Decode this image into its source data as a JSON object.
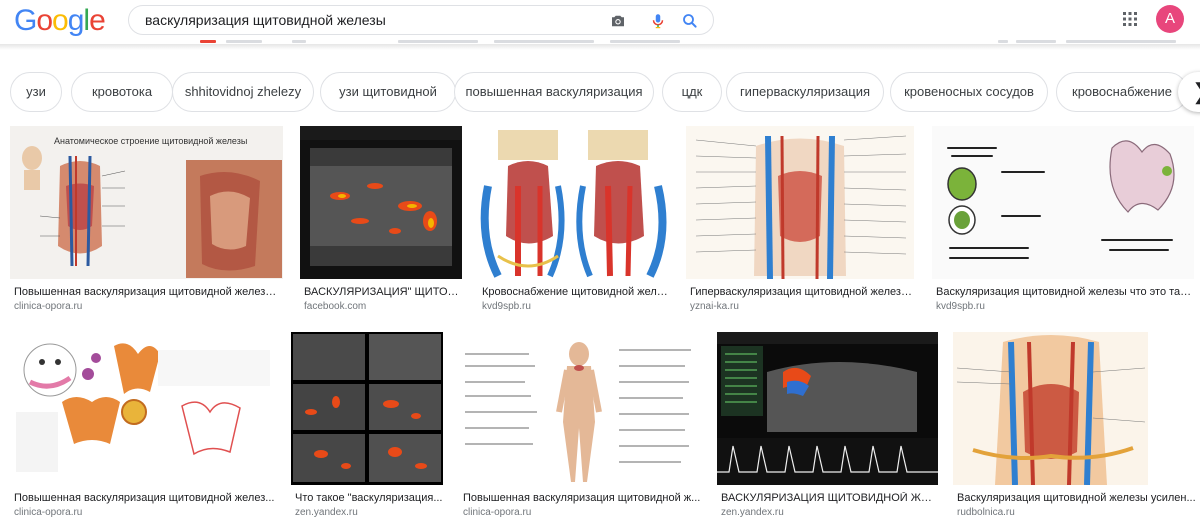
{
  "header": {
    "logo_letters": [
      {
        "ch": "G",
        "color": "#4285f4"
      },
      {
        "ch": "o",
        "color": "#ea4335"
      },
      {
        "ch": "o",
        "color": "#fbbc05"
      },
      {
        "ch": "g",
        "color": "#4285f4"
      },
      {
        "ch": "l",
        "color": "#34a853"
      },
      {
        "ch": "e",
        "color": "#ea4335"
      }
    ],
    "search_value": "васкуляризация щитовидной железы",
    "avatar_letter": "A",
    "avatar_color": "#e8467c",
    "icons": [
      "camera-icon",
      "microphone-icon",
      "search-icon",
      "apps-grid-icon"
    ]
  },
  "chips": [
    {
      "label": "узи"
    },
    {
      "label": "кровотока"
    },
    {
      "label": "shhitovidnoj zhelezy"
    },
    {
      "label": "узи щитовидной"
    },
    {
      "label": "повышенная васкуляризация"
    },
    {
      "label": "цдк"
    },
    {
      "label": "гиперваскуляризация"
    },
    {
      "label": "кровеносных сосудов"
    },
    {
      "label": "кровоснабжение"
    }
  ],
  "results": [
    {
      "title": "Повышенная васкуляризация щитовидной железы -...",
      "source": "clinica-opora.ru",
      "thumb_text": "Анатомическое строение щитовидной железы"
    },
    {
      "title": "ВАСКУЛЯРИЗАЦИЯ\" ЩИТОВИ...",
      "source": "facebook.com",
      "thumb_text": ""
    },
    {
      "title": "Кровоснабжение щитовидной желе...",
      "source": "kvd9spb.ru",
      "thumb_text": ""
    },
    {
      "title": "Гиперваскуляризация щитовидной железы...",
      "source": "yznai-ka.ru",
      "thumb_text": ""
    },
    {
      "title": "Васкуляризация щитовидной железы что это так...",
      "source": "kvd9spb.ru",
      "thumb_text": ""
    },
    {
      "title": "Повышенная васкуляризация щитовидной желез...",
      "source": "clinica-opora.ru",
      "thumb_text": ""
    },
    {
      "title": "Что такое \"васкуляризация...",
      "source": "zen.yandex.ru",
      "thumb_text": ""
    },
    {
      "title": "Повышенная васкуляризация щитовидной ж...",
      "source": "clinica-opora.ru",
      "thumb_text": ""
    },
    {
      "title": "ВАСКУЛЯРИЗАЦИЯ ЩИТОВИДНОЙ ЖЕЛЕ...",
      "source": "zen.yandex.ru",
      "thumb_text": ""
    },
    {
      "title": "Васкуляризация щитовидной железы усилен...",
      "source": "rudbolnica.ru",
      "thumb_text": ""
    }
  ]
}
